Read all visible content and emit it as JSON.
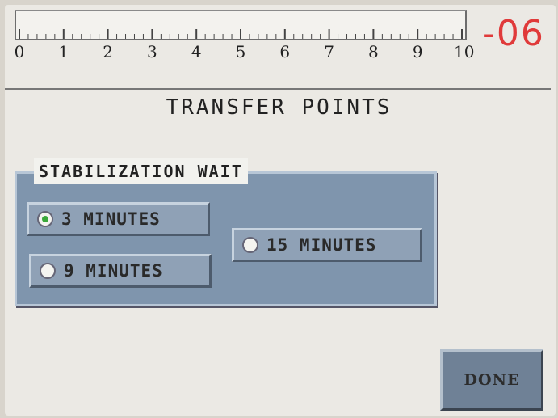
{
  "ruler": {
    "labels": [
      "0",
      "1",
      "2",
      "3",
      "4",
      "5",
      "6",
      "7",
      "8",
      "9",
      "10"
    ],
    "reading": "-06"
  },
  "title": "TRANSFER POINTS",
  "stabilization": {
    "label": "STABILIZATION WAIT",
    "options": [
      {
        "label": "3 MINUTES",
        "selected": true
      },
      {
        "label": "9 MINUTES",
        "selected": false
      },
      {
        "label": "15 MINUTES",
        "selected": false
      }
    ]
  },
  "done_label": "DONE",
  "colors": {
    "reading": "#e03a3a",
    "panel": "#7f95ad",
    "selected_dot": "#3aa83a"
  }
}
